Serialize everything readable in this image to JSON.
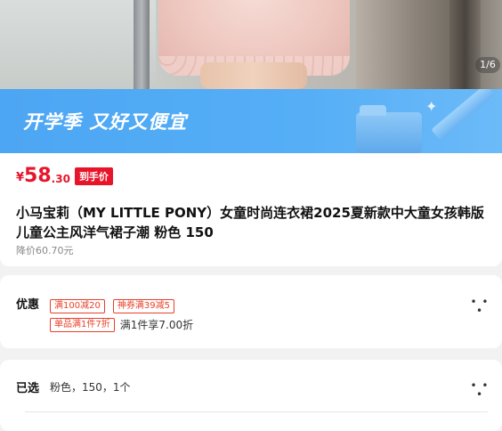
{
  "gallery": {
    "page_indicator": "1/6"
  },
  "banner": {
    "text": "开学季 又好又便宜"
  },
  "price": {
    "currency": "¥",
    "integer": "58",
    "decimal": ".30",
    "tag": "到手价",
    "original": "降价60.70元"
  },
  "product": {
    "title": "小马宝莉（MY LITTLE PONY）女童时尚连衣裙2025夏新款中大童女孩韩版儿童公主风洋气裙子潮 粉色 150"
  },
  "discount": {
    "label": "优惠",
    "coupons": [
      "满100减20",
      "神券满39减5"
    ],
    "deal_badge": "单品满1件7折",
    "deal_text": "满1件享7.00折",
    "more": "• • •"
  },
  "selection": {
    "label": "已选",
    "value": "粉色，150，1个",
    "more": "• • •"
  },
  "colors": {
    "price_red": "#e8142a",
    "banner_blue": "#4da6f3"
  }
}
